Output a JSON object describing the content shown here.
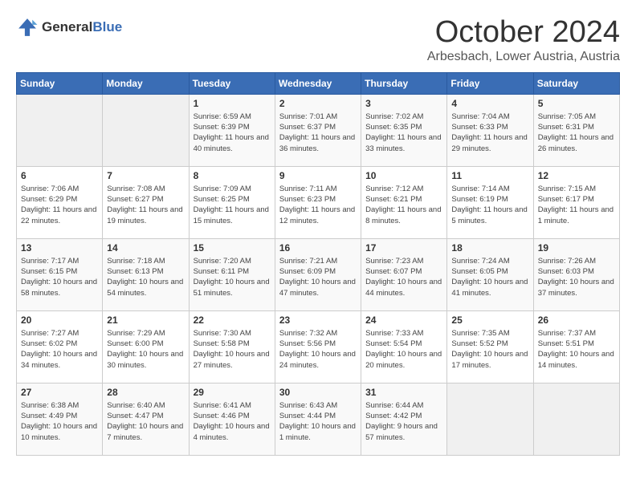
{
  "header": {
    "logo_general": "General",
    "logo_blue": "Blue",
    "month": "October 2024",
    "location": "Arbesbach, Lower Austria, Austria"
  },
  "days_of_week": [
    "Sunday",
    "Monday",
    "Tuesday",
    "Wednesday",
    "Thursday",
    "Friday",
    "Saturday"
  ],
  "weeks": [
    [
      {
        "day": "",
        "empty": true
      },
      {
        "day": "",
        "empty": true
      },
      {
        "day": "1",
        "sunrise": "Sunrise: 6:59 AM",
        "sunset": "Sunset: 6:39 PM",
        "daylight": "Daylight: 11 hours and 40 minutes."
      },
      {
        "day": "2",
        "sunrise": "Sunrise: 7:01 AM",
        "sunset": "Sunset: 6:37 PM",
        "daylight": "Daylight: 11 hours and 36 minutes."
      },
      {
        "day": "3",
        "sunrise": "Sunrise: 7:02 AM",
        "sunset": "Sunset: 6:35 PM",
        "daylight": "Daylight: 11 hours and 33 minutes."
      },
      {
        "day": "4",
        "sunrise": "Sunrise: 7:04 AM",
        "sunset": "Sunset: 6:33 PM",
        "daylight": "Daylight: 11 hours and 29 minutes."
      },
      {
        "day": "5",
        "sunrise": "Sunrise: 7:05 AM",
        "sunset": "Sunset: 6:31 PM",
        "daylight": "Daylight: 11 hours and 26 minutes."
      }
    ],
    [
      {
        "day": "6",
        "sunrise": "Sunrise: 7:06 AM",
        "sunset": "Sunset: 6:29 PM",
        "daylight": "Daylight: 11 hours and 22 minutes."
      },
      {
        "day": "7",
        "sunrise": "Sunrise: 7:08 AM",
        "sunset": "Sunset: 6:27 PM",
        "daylight": "Daylight: 11 hours and 19 minutes."
      },
      {
        "day": "8",
        "sunrise": "Sunrise: 7:09 AM",
        "sunset": "Sunset: 6:25 PM",
        "daylight": "Daylight: 11 hours and 15 minutes."
      },
      {
        "day": "9",
        "sunrise": "Sunrise: 7:11 AM",
        "sunset": "Sunset: 6:23 PM",
        "daylight": "Daylight: 11 hours and 12 minutes."
      },
      {
        "day": "10",
        "sunrise": "Sunrise: 7:12 AM",
        "sunset": "Sunset: 6:21 PM",
        "daylight": "Daylight: 11 hours and 8 minutes."
      },
      {
        "day": "11",
        "sunrise": "Sunrise: 7:14 AM",
        "sunset": "Sunset: 6:19 PM",
        "daylight": "Daylight: 11 hours and 5 minutes."
      },
      {
        "day": "12",
        "sunrise": "Sunrise: 7:15 AM",
        "sunset": "Sunset: 6:17 PM",
        "daylight": "Daylight: 11 hours and 1 minute."
      }
    ],
    [
      {
        "day": "13",
        "sunrise": "Sunrise: 7:17 AM",
        "sunset": "Sunset: 6:15 PM",
        "daylight": "Daylight: 10 hours and 58 minutes."
      },
      {
        "day": "14",
        "sunrise": "Sunrise: 7:18 AM",
        "sunset": "Sunset: 6:13 PM",
        "daylight": "Daylight: 10 hours and 54 minutes."
      },
      {
        "day": "15",
        "sunrise": "Sunrise: 7:20 AM",
        "sunset": "Sunset: 6:11 PM",
        "daylight": "Daylight: 10 hours and 51 minutes."
      },
      {
        "day": "16",
        "sunrise": "Sunrise: 7:21 AM",
        "sunset": "Sunset: 6:09 PM",
        "daylight": "Daylight: 10 hours and 47 minutes."
      },
      {
        "day": "17",
        "sunrise": "Sunrise: 7:23 AM",
        "sunset": "Sunset: 6:07 PM",
        "daylight": "Daylight: 10 hours and 44 minutes."
      },
      {
        "day": "18",
        "sunrise": "Sunrise: 7:24 AM",
        "sunset": "Sunset: 6:05 PM",
        "daylight": "Daylight: 10 hours and 41 minutes."
      },
      {
        "day": "19",
        "sunrise": "Sunrise: 7:26 AM",
        "sunset": "Sunset: 6:03 PM",
        "daylight": "Daylight: 10 hours and 37 minutes."
      }
    ],
    [
      {
        "day": "20",
        "sunrise": "Sunrise: 7:27 AM",
        "sunset": "Sunset: 6:02 PM",
        "daylight": "Daylight: 10 hours and 34 minutes."
      },
      {
        "day": "21",
        "sunrise": "Sunrise: 7:29 AM",
        "sunset": "Sunset: 6:00 PM",
        "daylight": "Daylight: 10 hours and 30 minutes."
      },
      {
        "day": "22",
        "sunrise": "Sunrise: 7:30 AM",
        "sunset": "Sunset: 5:58 PM",
        "daylight": "Daylight: 10 hours and 27 minutes."
      },
      {
        "day": "23",
        "sunrise": "Sunrise: 7:32 AM",
        "sunset": "Sunset: 5:56 PM",
        "daylight": "Daylight: 10 hours and 24 minutes."
      },
      {
        "day": "24",
        "sunrise": "Sunrise: 7:33 AM",
        "sunset": "Sunset: 5:54 PM",
        "daylight": "Daylight: 10 hours and 20 minutes."
      },
      {
        "day": "25",
        "sunrise": "Sunrise: 7:35 AM",
        "sunset": "Sunset: 5:52 PM",
        "daylight": "Daylight: 10 hours and 17 minutes."
      },
      {
        "day": "26",
        "sunrise": "Sunrise: 7:37 AM",
        "sunset": "Sunset: 5:51 PM",
        "daylight": "Daylight: 10 hours and 14 minutes."
      }
    ],
    [
      {
        "day": "27",
        "sunrise": "Sunrise: 6:38 AM",
        "sunset": "Sunset: 4:49 PM",
        "daylight": "Daylight: 10 hours and 10 minutes."
      },
      {
        "day": "28",
        "sunrise": "Sunrise: 6:40 AM",
        "sunset": "Sunset: 4:47 PM",
        "daylight": "Daylight: 10 hours and 7 minutes."
      },
      {
        "day": "29",
        "sunrise": "Sunrise: 6:41 AM",
        "sunset": "Sunset: 4:46 PM",
        "daylight": "Daylight: 10 hours and 4 minutes."
      },
      {
        "day": "30",
        "sunrise": "Sunrise: 6:43 AM",
        "sunset": "Sunset: 4:44 PM",
        "daylight": "Daylight: 10 hours and 1 minute."
      },
      {
        "day": "31",
        "sunrise": "Sunrise: 6:44 AM",
        "sunset": "Sunset: 4:42 PM",
        "daylight": "Daylight: 9 hours and 57 minutes."
      },
      {
        "day": "",
        "empty": true
      },
      {
        "day": "",
        "empty": true
      }
    ]
  ]
}
